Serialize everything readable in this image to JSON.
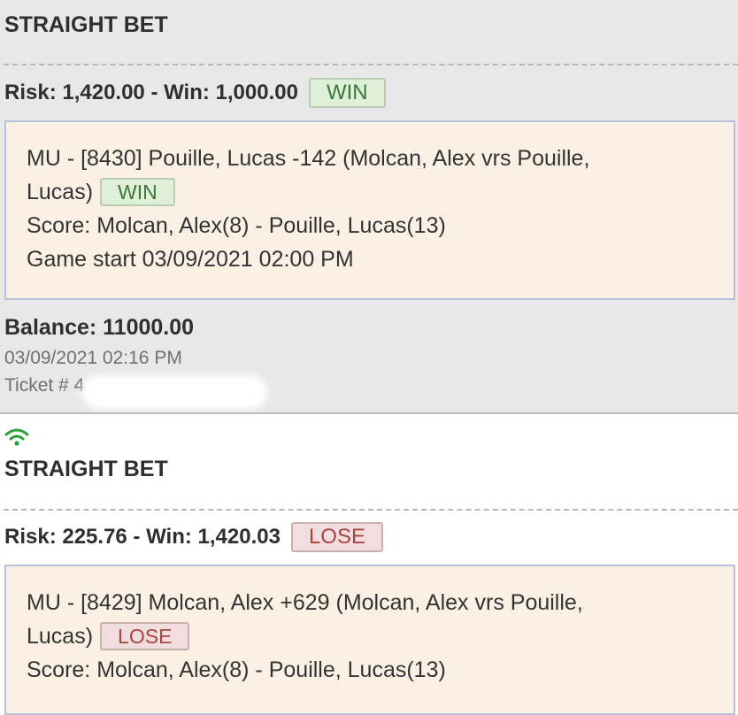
{
  "tickets": [
    {
      "bet_type": "STRAIGHT BET",
      "risk_win": "Risk: 1,420.00 - Win: 1,000.00",
      "result": "WIN",
      "line1": "MU - [8430] Pouille, Lucas -142 (Molcan, Alex vrs Pouille,",
      "line2": "Lucas)",
      "line2_result": "WIN",
      "score": "Score: Molcan, Alex(8) - Pouille, Lucas(13)",
      "game_start": "Game start 03/09/2021 02:00 PM",
      "balance": "Balance: 11000.00",
      "datetime": "03/09/2021 02:16 PM",
      "ticket": "Ticket # 4"
    },
    {
      "bet_type": "STRAIGHT BET",
      "risk_win": "Risk: 225.76 - Win: 1,420.03",
      "result": "LOSE",
      "line1": "MU - [8429] Molcan, Alex +629 (Molcan, Alex vrs Pouille,",
      "line2": "Lucas)",
      "line2_result": "LOSE",
      "score": "Score: Molcan, Alex(8) - Pouille, Lucas(13)"
    }
  ],
  "icons": {
    "status": "wifi-icon"
  },
  "colors": {
    "win": "#3c763d",
    "lose": "#a94442",
    "wifi": "#2e9e3a"
  }
}
